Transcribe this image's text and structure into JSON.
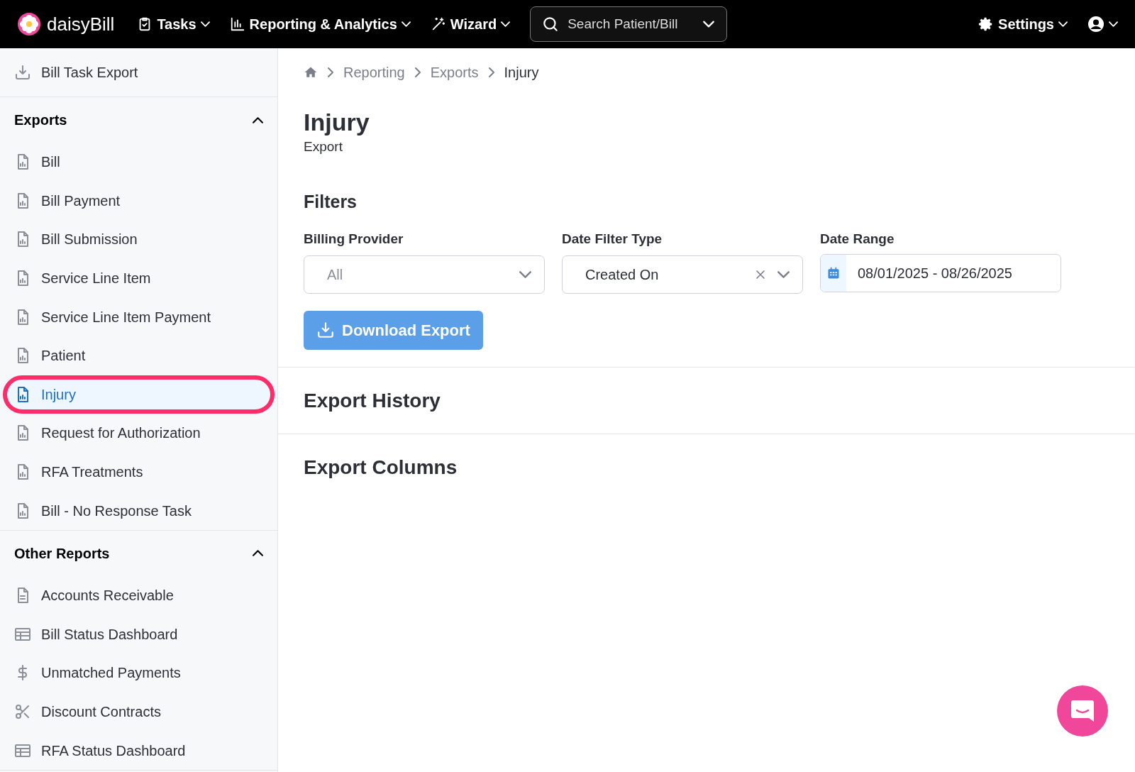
{
  "topbar": {
    "logo": "daisyBill",
    "menus": [
      {
        "kind": "tasks",
        "label": "Tasks"
      },
      {
        "kind": "chart",
        "label": "Reporting & Analytics"
      },
      {
        "kind": "wand",
        "label": "Wizard"
      }
    ],
    "search": {
      "placeholder": "Search Patient/Bill"
    },
    "settings": {
      "label": "Settings"
    }
  },
  "sidebar": {
    "top_items": [
      {
        "kind": "download",
        "label": "Bill Task Export",
        "selected": false,
        "highlighted": false
      }
    ],
    "groups": [
      {
        "title": "Exports",
        "expanded": true,
        "items": [
          {
            "kind": "report",
            "label": "Bill",
            "selected": false,
            "highlighted": false
          },
          {
            "kind": "report",
            "label": "Bill Payment",
            "selected": false,
            "highlighted": false
          },
          {
            "kind": "report",
            "label": "Bill Submission",
            "selected": false,
            "highlighted": false
          },
          {
            "kind": "report",
            "label": "Service Line Item",
            "selected": false,
            "highlighted": false
          },
          {
            "kind": "report",
            "label": "Service Line Item Payment",
            "selected": false,
            "highlighted": false
          },
          {
            "kind": "report",
            "label": "Patient",
            "selected": false,
            "highlighted": false
          },
          {
            "kind": "report",
            "label": "Injury",
            "selected": true,
            "highlighted": true
          },
          {
            "kind": "report",
            "label": "Request for Authorization",
            "selected": false,
            "highlighted": false
          },
          {
            "kind": "report",
            "label": "RFA Treatments",
            "selected": false,
            "highlighted": false
          },
          {
            "kind": "report",
            "label": "Bill - No Response Task",
            "selected": false,
            "highlighted": false
          }
        ]
      },
      {
        "title": "Other Reports",
        "expanded": true,
        "items": [
          {
            "kind": "document",
            "label": "Accounts Receivable",
            "selected": false,
            "highlighted": false
          },
          {
            "kind": "table",
            "label": "Bill Status Dashboard",
            "selected": false,
            "highlighted": false
          },
          {
            "kind": "dollar",
            "label": "Unmatched Payments",
            "selected": false,
            "highlighted": false
          },
          {
            "kind": "scissors",
            "label": "Discount Contracts",
            "selected": false,
            "highlighted": false
          },
          {
            "kind": "table",
            "label": "RFA Status Dashboard",
            "selected": false,
            "highlighted": false
          }
        ]
      }
    ]
  },
  "breadcrumb": [
    "Reporting",
    "Exports",
    "Injury"
  ],
  "page": {
    "title": "Injury",
    "subtitle": "Export"
  },
  "filters": {
    "title": "Filters",
    "fields": [
      {
        "kind": "select",
        "label": "Billing Provider",
        "placeholder": "All",
        "clearable": false
      },
      {
        "kind": "select",
        "label": "Date Filter Type",
        "value": "Created On",
        "clearable": true
      },
      {
        "kind": "date",
        "label": "Date Range",
        "value": "08/01/2025 - 08/26/2025"
      }
    ],
    "button": "Download Export"
  },
  "sections": [
    "Export History",
    "Export Columns"
  ]
}
